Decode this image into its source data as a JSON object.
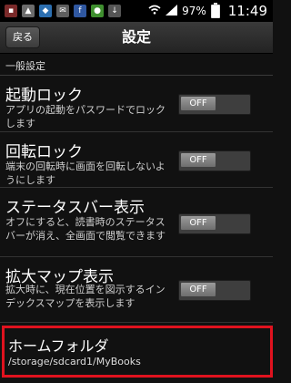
{
  "status_bar": {
    "notification_icons": [
      "sim-card-icon",
      "image-icon",
      "app-icon",
      "mail-icon",
      "file-icon",
      "android-icon",
      "download-icon"
    ],
    "battery_percent": "97%",
    "battery_level": 0.97,
    "time": "11:49"
  },
  "header": {
    "back_label": "戻る",
    "title": "設定"
  },
  "section": {
    "label": "一般設定"
  },
  "settings": [
    {
      "title": "起動ロック",
      "description": "アプリの起動をパスワードでロックします",
      "toggle": "OFF"
    },
    {
      "title": "回転ロック",
      "description": "端末の回転時に画面を回転しないようにします",
      "toggle": "OFF"
    },
    {
      "title": "ステータスバー表示",
      "description": "オフにすると、読書時のステータスバーが消え、全画面で閲覧できます",
      "toggle": "OFF"
    },
    {
      "title": "拡大マップ表示",
      "description": "拡大時に、現在位置を図示するインデックスマップを表示します",
      "toggle": "OFF"
    }
  ],
  "home_folder": {
    "title": "ホームフォルダ",
    "path": "/storage/sdcard1/MyBooks"
  },
  "colors": {
    "highlight_border": "#e0121e",
    "background": "#111111"
  }
}
